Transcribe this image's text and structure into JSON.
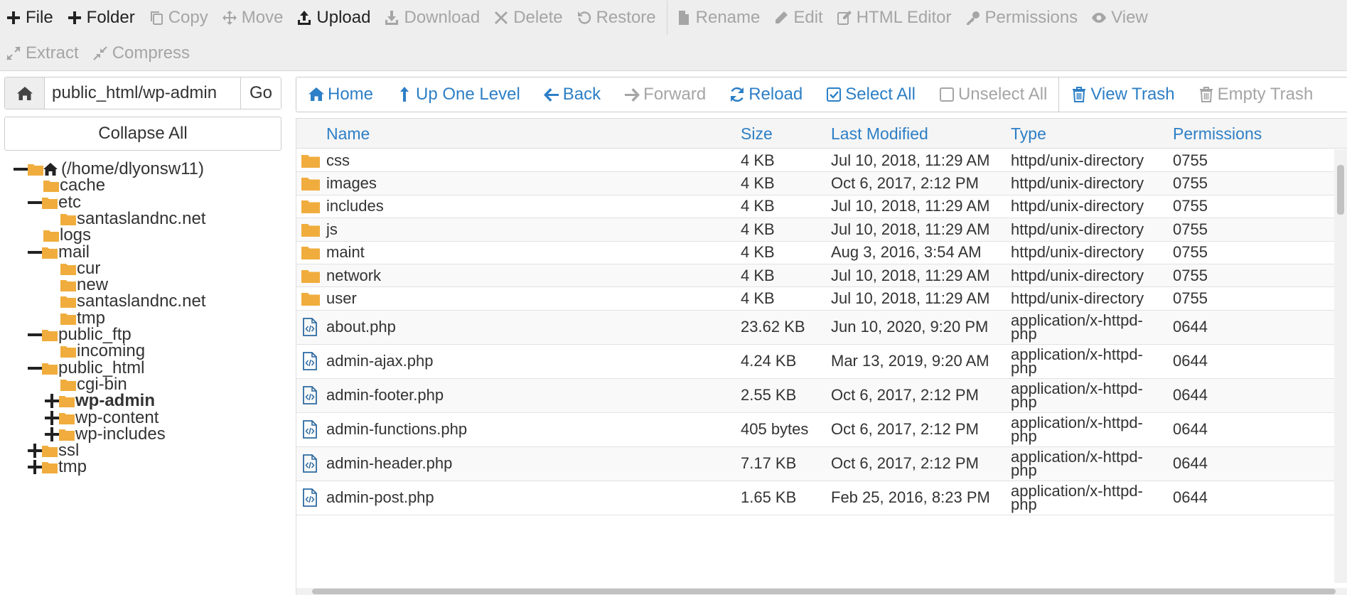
{
  "toolbar": {
    "row1": [
      {
        "name": "new-file-button",
        "icon": "plus-icon",
        "label": "File",
        "enabled": true
      },
      {
        "name": "new-folder-button",
        "icon": "plus-icon",
        "label": "Folder",
        "enabled": true
      },
      {
        "name": "copy-button",
        "icon": "copy-icon",
        "label": "Copy",
        "enabled": false
      },
      {
        "name": "move-button",
        "icon": "move-arrows-icon",
        "label": "Move",
        "enabled": false
      },
      {
        "name": "upload-button",
        "icon": "upload-icon",
        "label": "Upload",
        "enabled": true
      },
      {
        "name": "download-button",
        "icon": "download-icon",
        "label": "Download",
        "enabled": false
      },
      {
        "name": "delete-button",
        "icon": "times-icon",
        "label": "Delete",
        "enabled": false
      },
      {
        "name": "restore-button",
        "icon": "undo-icon",
        "label": "Restore",
        "enabled": false
      },
      {
        "name": "separator"
      },
      {
        "name": "rename-button",
        "icon": "file-icon",
        "label": "Rename",
        "enabled": false
      },
      {
        "name": "edit-button",
        "icon": "pencil-icon",
        "label": "Edit",
        "enabled": false
      },
      {
        "name": "html-editor-button",
        "icon": "edit-icon",
        "label": "HTML Editor",
        "enabled": false
      },
      {
        "name": "permissions-button",
        "icon": "key-icon",
        "label": "Permissions",
        "enabled": false
      },
      {
        "name": "view-button",
        "icon": "eye-icon",
        "label": "View",
        "enabled": false
      }
    ],
    "row2": [
      {
        "name": "extract-button",
        "icon": "expand-icon",
        "label": "Extract",
        "enabled": false
      },
      {
        "name": "compress-button",
        "icon": "compress-icon",
        "label": "Compress",
        "enabled": false
      }
    ]
  },
  "left": {
    "path_value": "public_html/wp-admin",
    "go_label": "Go",
    "collapse_label": "Collapse All",
    "tree": [
      {
        "label": "(/home/dlyonsw11)",
        "depth": 0,
        "toggle": "minus",
        "home": true
      },
      {
        "label": "cache",
        "depth": 1,
        "toggle": "none"
      },
      {
        "label": "etc",
        "depth": 1,
        "toggle": "minus"
      },
      {
        "label": "santaslandnc.net",
        "depth": 2,
        "toggle": "none"
      },
      {
        "label": "logs",
        "depth": 1,
        "toggle": "none"
      },
      {
        "label": "mail",
        "depth": 1,
        "toggle": "minus"
      },
      {
        "label": "cur",
        "depth": 2,
        "toggle": "none"
      },
      {
        "label": "new",
        "depth": 2,
        "toggle": "none"
      },
      {
        "label": "santaslandnc.net",
        "depth": 2,
        "toggle": "none"
      },
      {
        "label": "tmp",
        "depth": 2,
        "toggle": "none"
      },
      {
        "label": "public_ftp",
        "depth": 1,
        "toggle": "minus"
      },
      {
        "label": "incoming",
        "depth": 2,
        "toggle": "none"
      },
      {
        "label": "public_html",
        "depth": 1,
        "toggle": "minus"
      },
      {
        "label": "cgi-bin",
        "depth": 2,
        "toggle": "none"
      },
      {
        "label": "wp-admin",
        "depth": 2,
        "toggle": "plus",
        "selected": true
      },
      {
        "label": "wp-content",
        "depth": 2,
        "toggle": "plus"
      },
      {
        "label": "wp-includes",
        "depth": 2,
        "toggle": "plus"
      },
      {
        "label": "ssl",
        "depth": 1,
        "toggle": "plus"
      },
      {
        "label": "tmp",
        "depth": 1,
        "toggle": "plus"
      }
    ]
  },
  "nav": [
    {
      "name": "home-button",
      "icon": "home-icon",
      "label": "Home",
      "enabled": true
    },
    {
      "name": "up-one-level-button",
      "icon": "level-up-icon",
      "label": "Up One Level",
      "enabled": true
    },
    {
      "name": "back-button",
      "icon": "arrow-left-icon",
      "label": "Back",
      "enabled": true
    },
    {
      "name": "forward-button",
      "icon": "arrow-right-icon",
      "label": "Forward",
      "enabled": false
    },
    {
      "name": "reload-button",
      "icon": "refresh-icon",
      "label": "Reload",
      "enabled": true
    },
    {
      "name": "select-all-button",
      "icon": "checkbox-checked-icon",
      "label": "Select All",
      "enabled": true
    },
    {
      "name": "unselect-all-button",
      "icon": "checkbox-empty-icon",
      "label": "Unselect All",
      "enabled": false
    },
    {
      "name": "separator"
    },
    {
      "name": "view-trash-button",
      "icon": "trash-icon",
      "label": "View Trash",
      "enabled": true
    },
    {
      "name": "empty-trash-button",
      "icon": "trash-icon",
      "label": "Empty Trash",
      "enabled": false
    }
  ],
  "table": {
    "columns": [
      "Name",
      "Size",
      "Last Modified",
      "Type",
      "Permissions"
    ],
    "rows": [
      {
        "kind": "folder",
        "name": "css",
        "size": "4 KB",
        "modified": "Jul 10, 2018, 11:29 AM",
        "type": "httpd/unix-directory",
        "perms": "0755"
      },
      {
        "kind": "folder",
        "name": "images",
        "size": "4 KB",
        "modified": "Oct 6, 2017, 2:12 PM",
        "type": "httpd/unix-directory",
        "perms": "0755"
      },
      {
        "kind": "folder",
        "name": "includes",
        "size": "4 KB",
        "modified": "Jul 10, 2018, 11:29 AM",
        "type": "httpd/unix-directory",
        "perms": "0755"
      },
      {
        "kind": "folder",
        "name": "js",
        "size": "4 KB",
        "modified": "Jul 10, 2018, 11:29 AM",
        "type": "httpd/unix-directory",
        "perms": "0755"
      },
      {
        "kind": "folder",
        "name": "maint",
        "size": "4 KB",
        "modified": "Aug 3, 2016, 3:54 AM",
        "type": "httpd/unix-directory",
        "perms": "0755"
      },
      {
        "kind": "folder",
        "name": "network",
        "size": "4 KB",
        "modified": "Jul 10, 2018, 11:29 AM",
        "type": "httpd/unix-directory",
        "perms": "0755"
      },
      {
        "kind": "folder",
        "name": "user",
        "size": "4 KB",
        "modified": "Jul 10, 2018, 11:29 AM",
        "type": "httpd/unix-directory",
        "perms": "0755"
      },
      {
        "kind": "file",
        "name": "about.php",
        "size": "23.62 KB",
        "modified": "Jun 10, 2020, 9:20 PM",
        "type": "application/x-httpd-php",
        "perms": "0644"
      },
      {
        "kind": "file",
        "name": "admin-ajax.php",
        "size": "4.24 KB",
        "modified": "Mar 13, 2019, 9:20 AM",
        "type": "application/x-httpd-php",
        "perms": "0644"
      },
      {
        "kind": "file",
        "name": "admin-footer.php",
        "size": "2.55 KB",
        "modified": "Oct 6, 2017, 2:12 PM",
        "type": "application/x-httpd-php",
        "perms": "0644"
      },
      {
        "kind": "file",
        "name": "admin-functions.php",
        "size": "405 bytes",
        "modified": "Oct 6, 2017, 2:12 PM",
        "type": "application/x-httpd-php",
        "perms": "0644"
      },
      {
        "kind": "file",
        "name": "admin-header.php",
        "size": "7.17 KB",
        "modified": "Oct 6, 2017, 2:12 PM",
        "type": "application/x-httpd-php",
        "perms": "0644"
      },
      {
        "kind": "file",
        "name": "admin-post.php",
        "size": "1.65 KB",
        "modified": "Feb 25, 2016, 8:23 PM",
        "type": "application/x-httpd-php",
        "perms": "0644"
      }
    ]
  },
  "colors": {
    "link": "#2d7fc6",
    "disabled": "#a5a5a5",
    "folder": "#f0ad3d",
    "toolbar_bg": "#eeeeee"
  }
}
